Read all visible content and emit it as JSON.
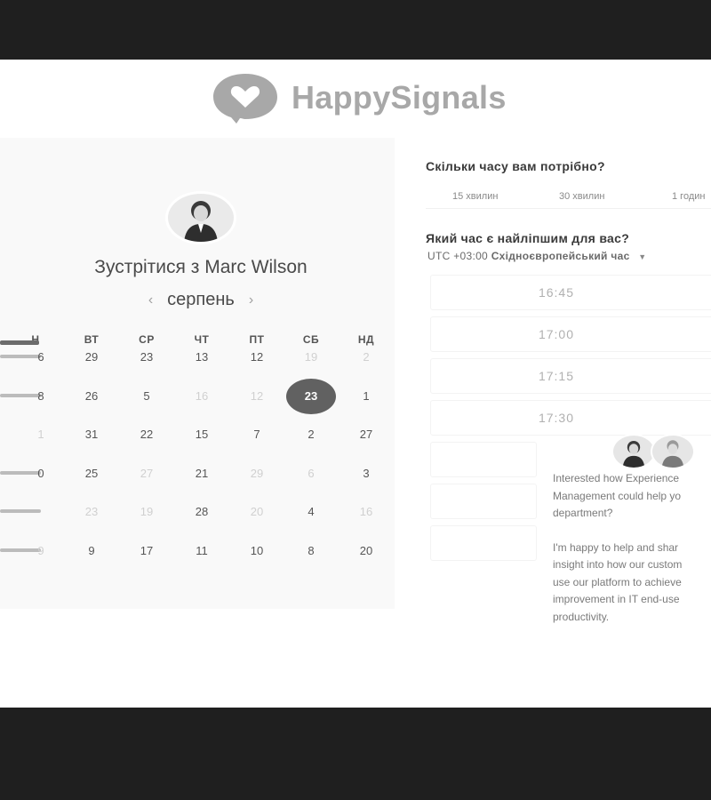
{
  "brand": {
    "name": "HappySignals",
    "color": "#a8a8a8"
  },
  "left": {
    "meet_title": "Зустрітися з Marc Wilson",
    "month": "серпень",
    "prev_icon": "chevron-left-icon",
    "next_icon": "chevron-right-icon",
    "weekdays": [
      "Н",
      "ВТ",
      "СР",
      "ЧТ",
      "ПТ",
      "СБ",
      "НД"
    ],
    "rows": [
      {
        "first": "6",
        "cells": [
          {
            "t": "29",
            "d": false
          },
          {
            "t": "23",
            "d": false
          },
          {
            "t": "13",
            "d": false
          },
          {
            "t": "12",
            "d": false
          },
          {
            "t": "19",
            "d": true
          },
          {
            "t": "2",
            "d": true
          }
        ]
      },
      {
        "first": "8",
        "cells": [
          {
            "t": "26",
            "d": false
          },
          {
            "t": "5",
            "d": false
          },
          {
            "t": "16",
            "d": true
          },
          {
            "t": "12",
            "d": true
          },
          {
            "t": "23",
            "d": false,
            "sel": true
          },
          {
            "t": "1",
            "d": false
          }
        ]
      },
      {
        "first": "1",
        "cells": [
          {
            "t": "31",
            "d": false
          },
          {
            "t": "22",
            "d": false
          },
          {
            "t": "15",
            "d": false
          },
          {
            "t": "7",
            "d": false
          },
          {
            "t": "2",
            "d": false
          },
          {
            "t": "27",
            "d": false
          }
        ]
      },
      {
        "first": "0",
        "cells": [
          {
            "t": "25",
            "d": false
          },
          {
            "t": "27",
            "d": true
          },
          {
            "t": "21",
            "d": false
          },
          {
            "t": "29",
            "d": true
          },
          {
            "t": "6",
            "d": true
          },
          {
            "t": "3",
            "d": false
          }
        ]
      },
      {
        "first": "",
        "cells": [
          {
            "t": "23",
            "d": true
          },
          {
            "t": "19",
            "d": true
          },
          {
            "t": "28",
            "d": false
          },
          {
            "t": "20",
            "d": true
          },
          {
            "t": "4",
            "d": false
          },
          {
            "t": "16",
            "d": true
          }
        ]
      },
      {
        "first": "9",
        "cells": [
          {
            "t": "9",
            "d": false
          },
          {
            "t": "17",
            "d": false
          },
          {
            "t": "11",
            "d": false
          },
          {
            "t": "10",
            "d": false
          },
          {
            "t": "8",
            "d": false
          },
          {
            "t": "20",
            "d": false
          }
        ]
      }
    ],
    "selected_color": "#616161"
  },
  "right": {
    "q_duration": "Скільки часу вам потрібно?",
    "durations": [
      "15 хвилин",
      "30 хвилин",
      "1 годин"
    ],
    "q_time": "Який час є найліпшим для вас?",
    "tz_offset": "UTC +03:00",
    "tz_name": "Східноєвропейський час",
    "tz_caret_icon": "caret-down-icon",
    "slots": [
      "16:45",
      "17:00",
      "17:15",
      "17:30"
    ]
  },
  "chat": {
    "p1": "Interested how Experience\nManagement could help yo\ndepartment?",
    "p2": "I'm happy to help and shar\ninsight into how our custom\nuse our platform to achieve\nimprovement in IT end-use\nproductivity."
  }
}
